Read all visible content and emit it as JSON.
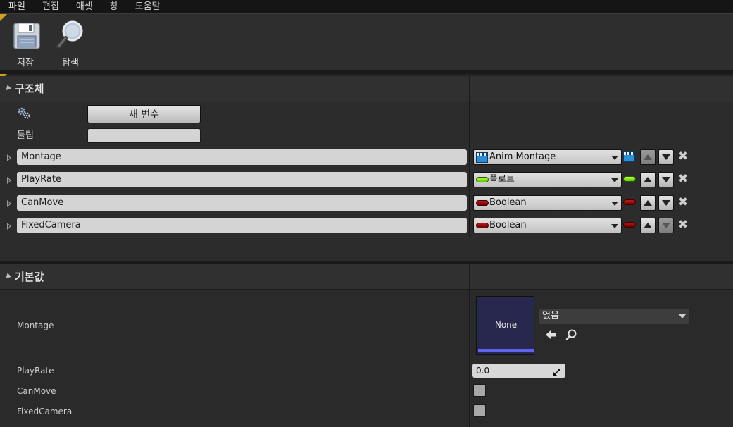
{
  "menu": {
    "items": [
      "파일",
      "편집",
      "애셋",
      "창",
      "도움말"
    ]
  },
  "toolbar": {
    "save_label": "저장",
    "browse_label": "탐색"
  },
  "structure": {
    "title": "구조체",
    "new_variable_label": "새 변수",
    "tooltip_label": "툴팁",
    "tooltip_value": "",
    "variables": [
      {
        "name": "Montage",
        "type": "Anim Montage",
        "type_icon": "anim-montage-icon",
        "up_enabled": false,
        "down_enabled": true
      },
      {
        "name": "PlayRate",
        "type": "플로트",
        "type_icon": "float-pill-icon",
        "up_enabled": true,
        "down_enabled": true
      },
      {
        "name": "CanMove",
        "type": "Boolean",
        "type_icon": "boolean-pill-icon",
        "up_enabled": true,
        "down_enabled": true
      },
      {
        "name": "FixedCamera",
        "type": "Boolean",
        "type_icon": "boolean-pill-icon",
        "up_enabled": true,
        "down_enabled": false
      }
    ]
  },
  "defaults": {
    "title": "기본값",
    "montage": {
      "label": "Montage",
      "thumbnail_text": "None",
      "asset_value": "없음"
    },
    "playrate": {
      "label": "PlayRate",
      "value": "0.0"
    },
    "canmove": {
      "label": "CanMove",
      "checked": false
    },
    "fixedcamera": {
      "label": "FixedCamera",
      "checked": false
    }
  },
  "colors": {
    "accent_gold": "#c9a31f",
    "float_green": "#7fe000",
    "bool_red": "#a00000",
    "montage_blue": "#2a8fd8",
    "thumb_bar": "#6262f0"
  }
}
